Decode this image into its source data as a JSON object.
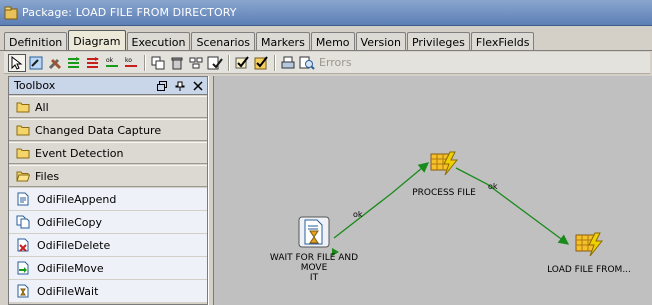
{
  "window": {
    "title": "Package: LOAD FILE  FROM DIRECTORY"
  },
  "tabs": [
    "Definition",
    "Diagram",
    "Execution",
    "Scenarios",
    "Markers",
    "Memo",
    "Version",
    "Privileges",
    "FlexFields"
  ],
  "active_tab": "Diagram",
  "toolbar": {
    "errors_label": "Errors"
  },
  "toolbox": {
    "title": "Toolbox",
    "folders": [
      "All",
      "Changed Data Capture",
      "Event Detection",
      "Files"
    ],
    "items": [
      "OdiFileAppend",
      "OdiFileCopy",
      "OdiFileDelete",
      "OdiFileMove",
      "OdiFileWait"
    ]
  },
  "diagram": {
    "nodes": {
      "wait": {
        "label": "WAIT FOR FILE AND MOVE IT",
        "line1": "WAIT FOR FILE AND",
        "line2": "MOVE",
        "line3": "IT"
      },
      "process": {
        "label": "PROCESS FILE"
      },
      "load": {
        "label": "LOAD FILE  FROM..."
      }
    },
    "links": [
      {
        "from": "wait",
        "to": "process",
        "label": "ok"
      },
      {
        "from": "process",
        "to": "load",
        "label": "ok"
      }
    ]
  }
}
